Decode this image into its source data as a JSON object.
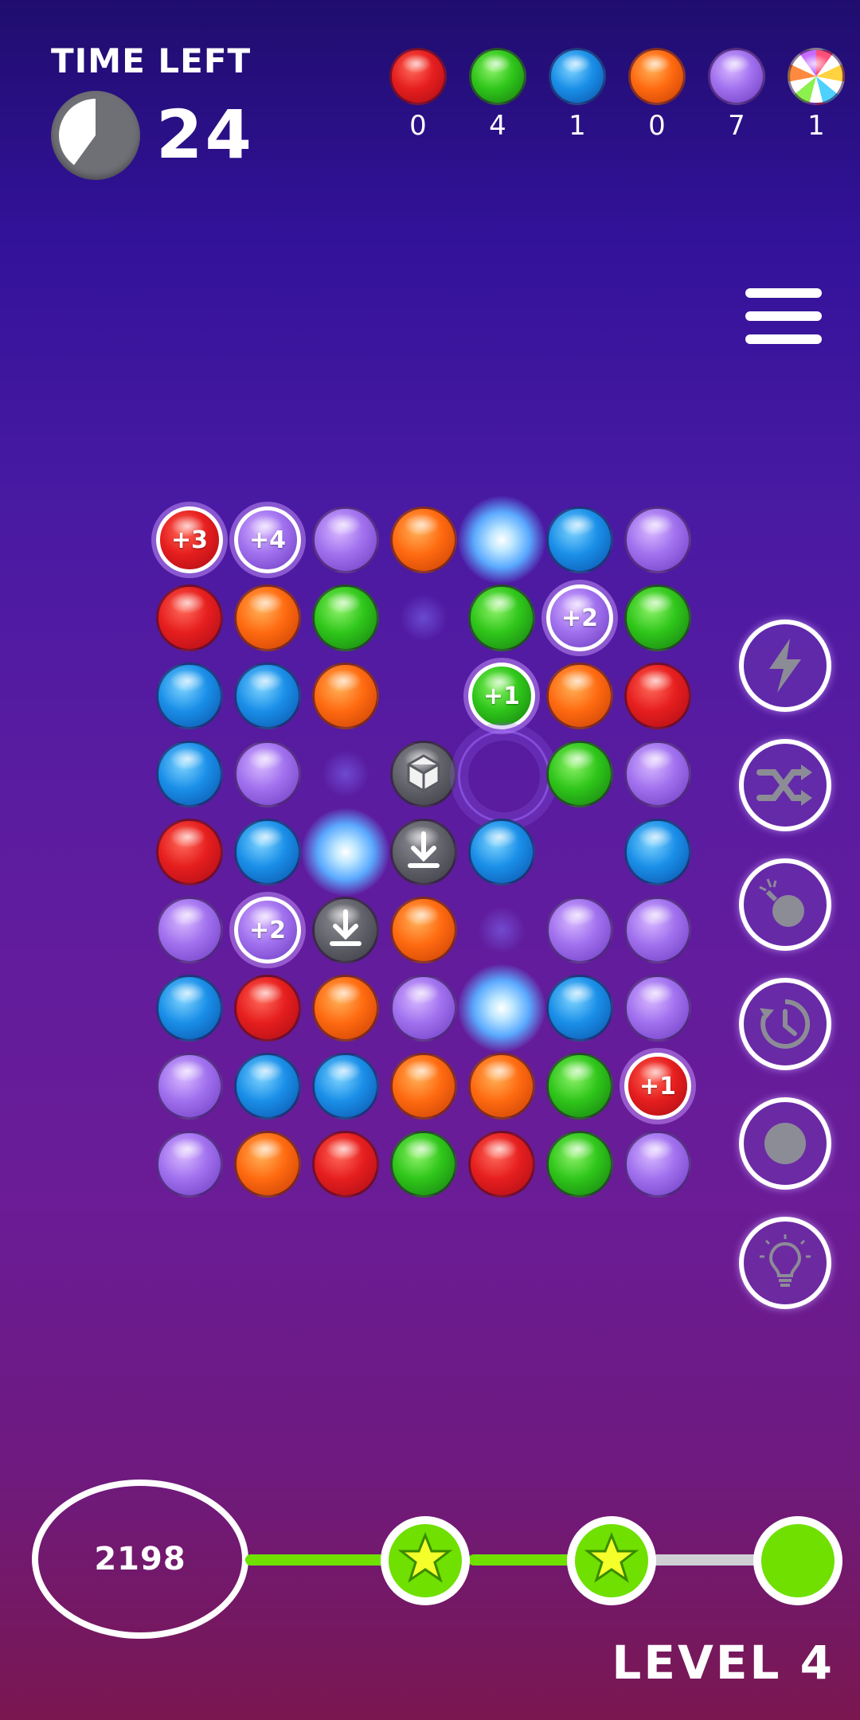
{
  "hud": {
    "time_label": "TIME LEFT",
    "time_value": "24",
    "timer_fraction_remaining": 0.4
  },
  "collect_counters": [
    {
      "color": "red",
      "count": "0"
    },
    {
      "color": "green",
      "count": "4"
    },
    {
      "color": "blue",
      "count": "1"
    },
    {
      "color": "orange",
      "count": "0"
    },
    {
      "color": "purple",
      "count": "7"
    },
    {
      "color": "candy",
      "count": "1"
    }
  ],
  "menu_icon": "hamburger-menu-icon",
  "board": {
    "rows": [
      [
        "red+3",
        "purple+4",
        "purple",
        "orange",
        "spark",
        "blue",
        "purple"
      ],
      [
        "red",
        "orange",
        "green",
        "glow",
        "green",
        "purple+2",
        "green"
      ],
      [
        "blue",
        "blue",
        "orange",
        "empty",
        "green+1",
        "orange",
        "red"
      ],
      [
        "blue",
        "purple",
        "glow",
        "cube",
        "vortex",
        "green",
        "purple"
      ],
      [
        "red",
        "blue",
        "spark",
        "drop",
        "blue",
        "empty",
        "blue"
      ],
      [
        "purple",
        "purple+2",
        "drop",
        "orange",
        "glow",
        "purple",
        "purple"
      ],
      [
        "blue",
        "red",
        "orange",
        "purple",
        "spark",
        "blue",
        "purple"
      ],
      [
        "purple",
        "blue",
        "blue",
        "orange",
        "orange",
        "green",
        "red+1"
      ],
      [
        "purple",
        "orange",
        "red",
        "green",
        "red",
        "green",
        "purple"
      ]
    ]
  },
  "powerups": [
    {
      "icon": "lightning-icon",
      "name": "powerup-lightning"
    },
    {
      "icon": "shuffle-icon",
      "name": "powerup-shuffle"
    },
    {
      "icon": "bomb-icon",
      "name": "powerup-bomb"
    },
    {
      "icon": "time-rewind-icon",
      "name": "powerup-time"
    },
    {
      "icon": "record-dot-icon",
      "name": "powerup-dot"
    },
    {
      "icon": "lightbulb-icon",
      "name": "powerup-hint"
    }
  ],
  "footer": {
    "score": "2198",
    "stars_earned": 2,
    "stars_total": 3,
    "level_label": "LEVEL 4"
  },
  "colors": {
    "accent_green": "#6fe000",
    "progress_gray": "#cfcfd4"
  }
}
